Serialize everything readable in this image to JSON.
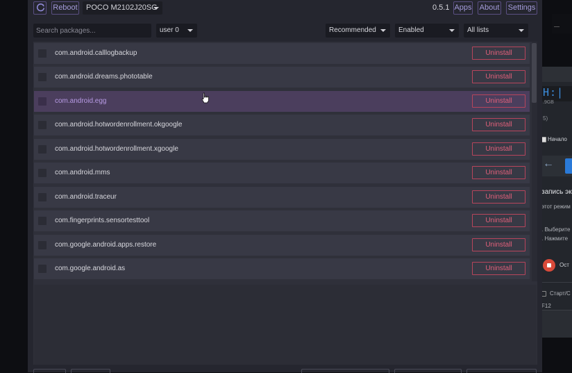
{
  "toolbar": {
    "refresh_icon": "refresh-icon",
    "reboot_label": "Reboot",
    "device": "POCO M2102J20SG",
    "version": "0.5.1",
    "apps_label": "Apps",
    "about_label": "About",
    "settings_label": "Settings"
  },
  "filters": {
    "search_placeholder": "Search packages...",
    "user": "user 0",
    "recommendation": "Recommended",
    "state": "Enabled",
    "lists": "All lists"
  },
  "packages": [
    {
      "name": "com.android.calllogbackup",
      "action": "Uninstall"
    },
    {
      "name": "com.android.dreams.phototable",
      "action": "Uninstall"
    },
    {
      "name": "com.android.egg",
      "action": "Uninstall"
    },
    {
      "name": "com.android.hotwordenrollment.okgoogle",
      "action": "Uninstall"
    },
    {
      "name": "com.android.hotwordenrollment.xgoogle",
      "action": "Uninstall"
    },
    {
      "name": "com.android.mms",
      "action": "Uninstall"
    },
    {
      "name": "com.android.traceur",
      "action": "Uninstall"
    },
    {
      "name": "com.fingerprints.sensortesttool",
      "action": "Uninstall"
    },
    {
      "name": "com.google.android.apps.restore",
      "action": "Uninstall"
    },
    {
      "name": "com.google.android.as",
      "action": "Uninstall"
    }
  ],
  "background_window": {
    "segment_text": "H:|",
    "size_text": ".9GB",
    "small_text": "5)",
    "start_label": "Начало",
    "heading": "запись эк",
    "line1": "этот режим",
    "line2": ". Выберите",
    "line3": ". Нажмите",
    "stop_label": "Ост",
    "hotkey_label": "Старт/С",
    "key": "F12"
  },
  "colors": {
    "accent": "#a59cdc",
    "danger": "#e0607a",
    "hover_row": "#4b3e5d"
  }
}
